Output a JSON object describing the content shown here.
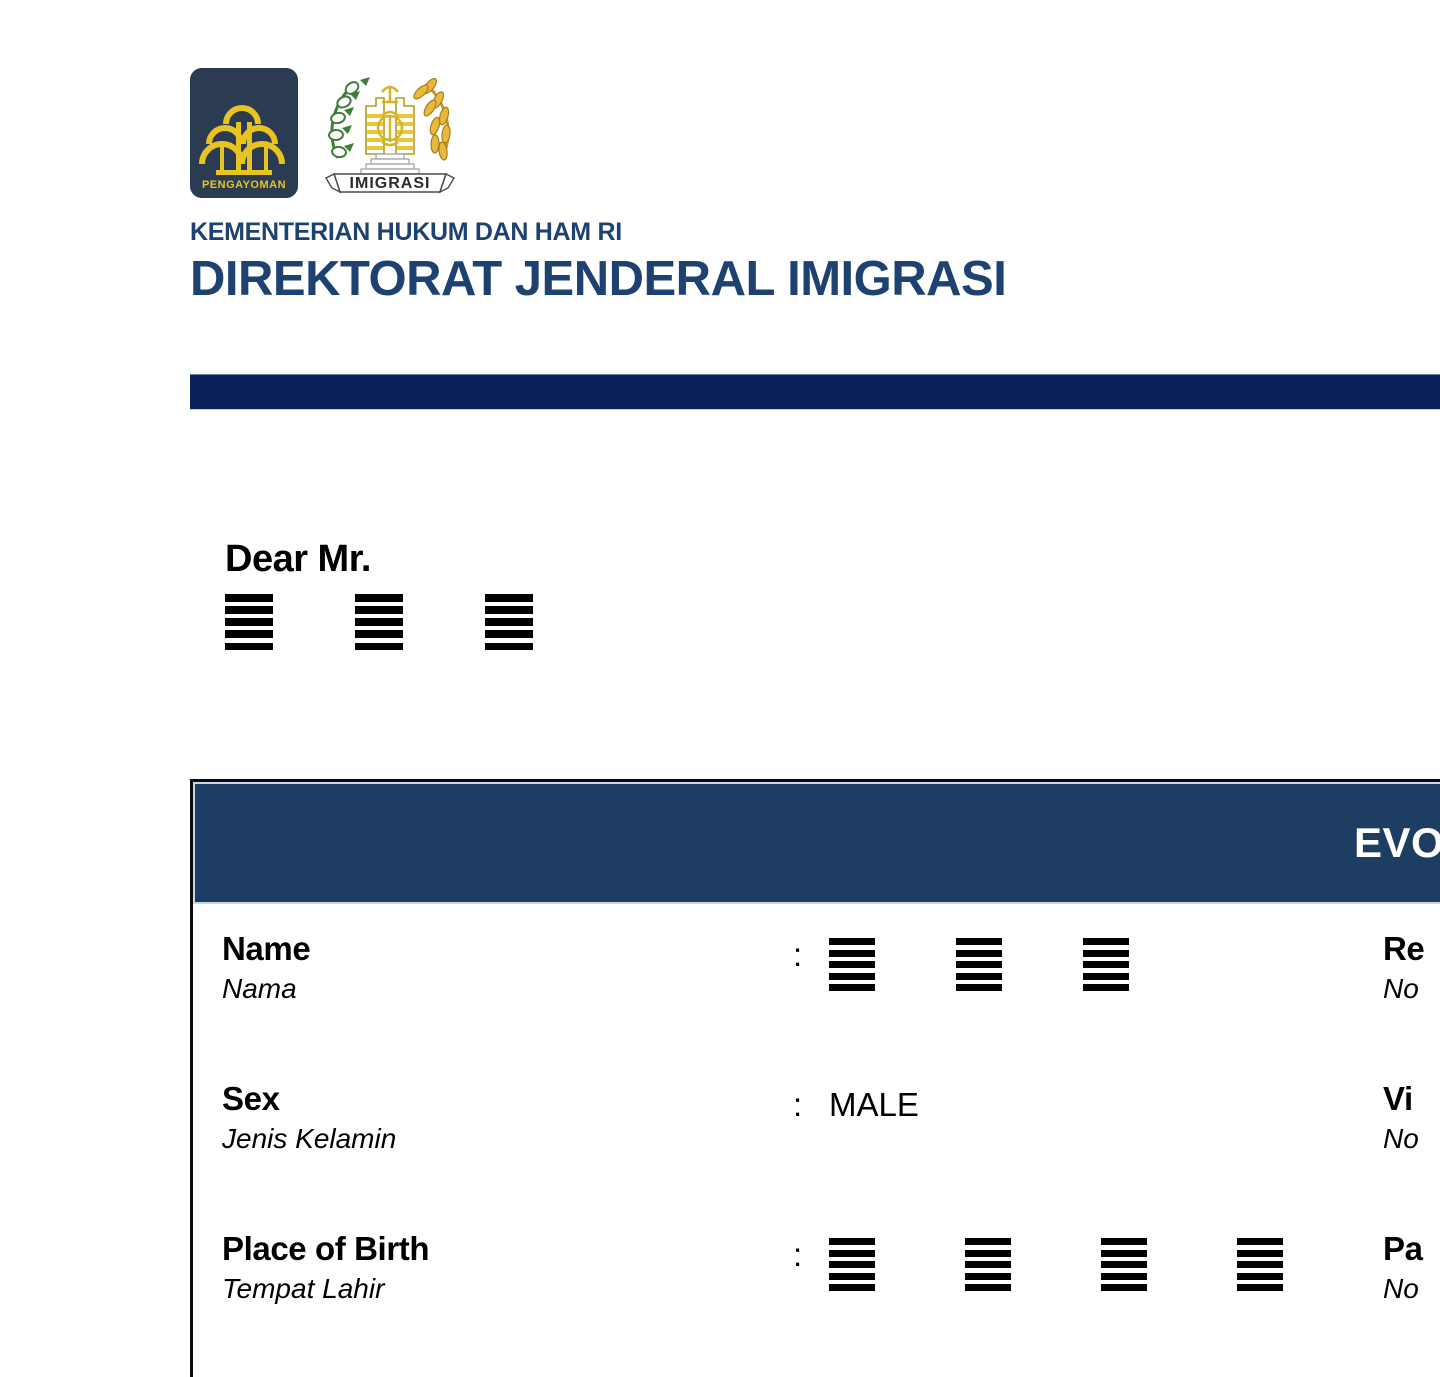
{
  "document": {
    "background_color": "#ffffff",
    "brand_navy": "#1d4271",
    "divider_color": "#0a2259",
    "table_header_color": "#1d3e62"
  },
  "letterhead": {
    "logo_pengayoman_label": "PENGAYOMAN",
    "logo_imigrasi_label": "IMIGRASI",
    "ministry_line": "KEMENTERIAN HUKUM DAN HAM RI",
    "directorate_line": "DIREKTORAT JENDERAL IMIGRASI"
  },
  "salutation": {
    "greeting": "Dear Mr.",
    "redacted_name_blocks": 3
  },
  "table": {
    "header_title": "EVOA",
    "rows": [
      {
        "label_en": "Name",
        "label_id": "Nama",
        "separator": ":",
        "value_type": "redacted",
        "redaction_blocks": 3,
        "value_text": "",
        "right_label_en": "Re",
        "right_label_id": "No"
      },
      {
        "label_en": "Sex",
        "label_id": "Jenis Kelamin",
        "separator": ":",
        "value_type": "text",
        "redaction_blocks": 0,
        "value_text": "MALE",
        "right_label_en": "Vi",
        "right_label_id": "No"
      },
      {
        "label_en": "Place of Birth",
        "label_id": "Tempat Lahir",
        "separator": ":",
        "value_type": "redacted",
        "redaction_blocks": 4,
        "value_text": "",
        "right_label_en": "Pa",
        "right_label_id": "No"
      }
    ]
  }
}
